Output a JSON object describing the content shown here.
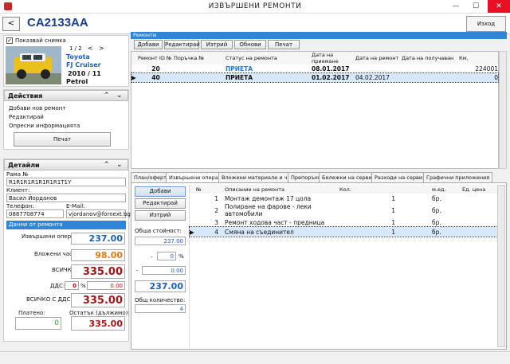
{
  "window": {
    "title": "ИЗВЪРШЕНИ РЕМОНТИ",
    "min": "—",
    "max": "☐",
    "close": "✕"
  },
  "header": {
    "back": "<",
    "plate": "CA2133AA",
    "exit_label": "Изход"
  },
  "vehicle": {
    "show_image_label": "Показвай снимка",
    "pager": "1 / 2",
    "prev": "<",
    "next": ">",
    "make": "Toyota",
    "model": "FJ Cruiser",
    "year": "2010",
    "month": "/ 11",
    "fuel": "Petrol"
  },
  "actions": {
    "title": "Действия",
    "items": [
      "Добави нов ремонт",
      "Редактирай",
      "Опресни информацията"
    ],
    "print_label": "Печат"
  },
  "details": {
    "title": "Детайли",
    "vin_label": "Рама №",
    "vin_value": "R1R1R1R1R1R1R1T1Y",
    "client_label": "Клиент:",
    "client_value": "Васил Йорданов",
    "phone_label": "Телефон:",
    "phone_value": "0887708774",
    "email_label": "E-Mail:",
    "email_value": "vjordanov@fornext.bg",
    "section_label": "Данни от ремонта",
    "ops_label": "Извършени операции:",
    "ops_value": "237.00",
    "parts_label": "Вложени части:",
    "parts_value": "98.00",
    "total_label": "ВСИЧКО:",
    "total_value": "335.00",
    "vat_label": "ДДС:",
    "vat_pct": "0",
    "pct_sign": "%",
    "vat_value": "0.00",
    "total_vat_label": "ВСИЧКО С ДДС:",
    "total_vat_value": "335.00",
    "paid_label": "Платено:",
    "paid_value": "0",
    "remaining_label": "Остатък (дължимо):",
    "remaining_value": "335.00"
  },
  "repairs": {
    "section_title": "Ремонти",
    "toolbar": [
      "Добави",
      "Редактирай",
      "Изтрий",
      "Обнови",
      "Печат"
    ],
    "columns": [
      "Ремонт ID №",
      "Поръчка №",
      "Статус на ремонта",
      "Дата на приемане",
      "Дата на ремонт",
      "Дата на получаван",
      "Км."
    ],
    "rows": [
      {
        "marker": "",
        "id": "20",
        "order": "",
        "status": "ПРИЕТА",
        "date_in": "08.01.2017",
        "date_repair": "",
        "date_out": "",
        "km": "224001"
      },
      {
        "marker": "▶",
        "id": "40",
        "order": "",
        "status": "ПРИЕТА",
        "date_in": "01.02.2017",
        "date_repair": "04.02.2017",
        "date_out": "",
        "km": "0"
      }
    ]
  },
  "tabs": [
    "План/оферта",
    "Извършени операции",
    "Вложени материали и части",
    "Препоръки",
    "Бележки на сервиза",
    "Разходи на сервиза",
    "Графични приложения"
  ],
  "ops": {
    "add": "Добави",
    "edit": "Редактирай",
    "delete": "Изтрий",
    "total_price_label": "Обща стойност:",
    "total_price": "237.00",
    "minus": "-",
    "discount_pct": "0",
    "pct_sign": "%",
    "discount_value": "0.00",
    "net_total": "237.00",
    "qty_label": "Общ количество:",
    "qty_value": "4",
    "columns": [
      "№",
      "Описание на ремонта",
      "Кол.",
      "м.ед.",
      "Ед. цена"
    ],
    "rows": [
      {
        "marker": "",
        "n": "1",
        "desc": "Монтаж демонтаж 17 цола",
        "qty": "1",
        "unit": "бр."
      },
      {
        "marker": "",
        "n": "2",
        "desc": "Полиране на фарове - леки автомобили",
        "qty": "1",
        "unit": "бр."
      },
      {
        "marker": "",
        "n": "3",
        "desc": "Ремонт ходова част - предница",
        "qty": "1",
        "unit": "бр."
      },
      {
        "marker": "▶",
        "n": "4",
        "desc": "Смяна на съединител",
        "qty": "1",
        "unit": "бр."
      }
    ]
  }
}
